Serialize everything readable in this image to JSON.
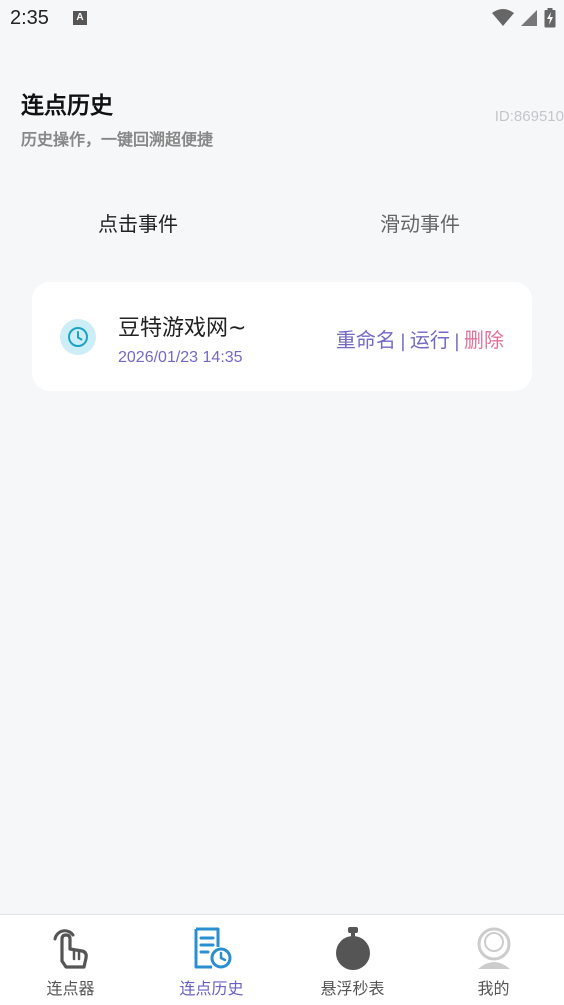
{
  "status_bar": {
    "time": "2:35",
    "notification_icon_letter": "A",
    "icons": [
      "wifi-icon",
      "signal-icon",
      "battery-charging-icon"
    ]
  },
  "header": {
    "title": "连点历史",
    "subtitle": "历史操作，一键回溯超便捷",
    "device_id": "ID:869510"
  },
  "tabs": [
    {
      "label": "点击事件",
      "selected": true
    },
    {
      "label": "滑动事件",
      "selected": false
    }
  ],
  "history": [
    {
      "name": "豆特游戏网~",
      "timestamp": "2026/01/23 14:35",
      "icon": "clock-icon",
      "actions": {
        "rename": "重命名",
        "separator": "|",
        "run": "运行",
        "delete": "删除"
      }
    }
  ],
  "bottom_nav": [
    {
      "label": "连点器",
      "icon": "tap-hand-icon",
      "active": false
    },
    {
      "label": "连点历史",
      "icon": "history-list-icon",
      "active": true
    },
    {
      "label": "悬浮秒表",
      "icon": "stopwatch-icon",
      "active": false
    },
    {
      "label": "我的",
      "icon": "profile-icon",
      "active": false
    }
  ],
  "colors": {
    "accent": "#6a5fc4",
    "danger": "#e0729a",
    "clock_badge": "#cdeef7",
    "clock_stroke": "#1aa3c4",
    "background": "#f6f7f9"
  }
}
